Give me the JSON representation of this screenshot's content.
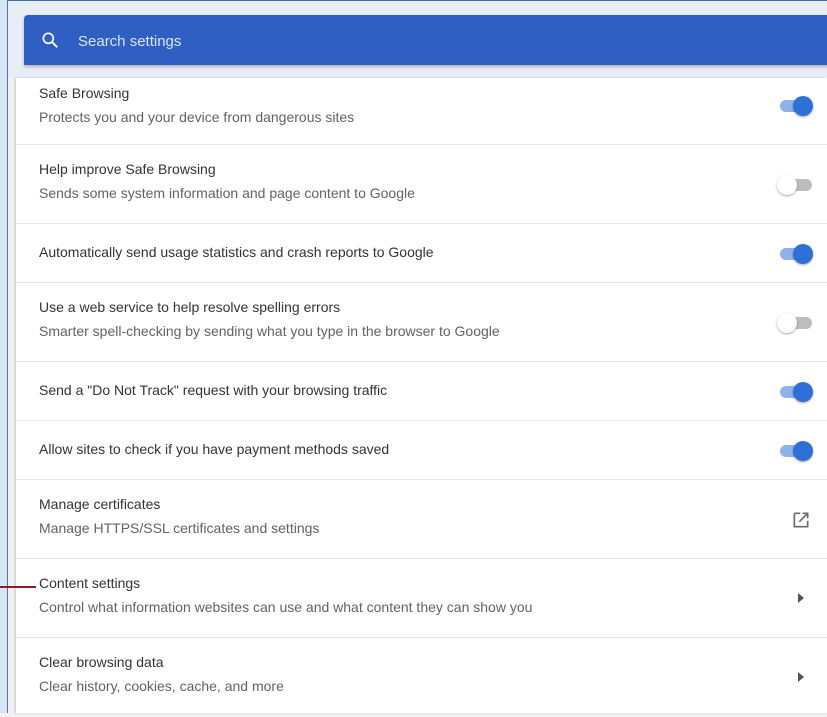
{
  "search": {
    "placeholder": "Search settings",
    "value": ""
  },
  "rows": [
    {
      "title": "Safe Browsing",
      "subtitle": "Protects you and your device from dangerous sites",
      "control": "toggle",
      "checked": true
    },
    {
      "title": "Help improve Safe Browsing",
      "subtitle": "Sends some system information and page content to Google",
      "control": "toggle",
      "checked": false
    },
    {
      "title": "Automatically send usage statistics and crash reports to Google",
      "control": "toggle",
      "checked": true
    },
    {
      "title": "Use a web service to help resolve spelling errors",
      "subtitle": "Smarter spell-checking by sending what you type in the browser to Google",
      "control": "toggle",
      "checked": false
    },
    {
      "title": "Send a \"Do Not Track\" request with your browsing traffic",
      "control": "toggle",
      "checked": true
    },
    {
      "title": "Allow sites to check if you have payment methods saved",
      "control": "toggle",
      "checked": true
    },
    {
      "title": "Manage certificates",
      "subtitle": "Manage HTTPS/SSL certificates and settings",
      "control": "external-link-icon"
    },
    {
      "title": "Content settings",
      "subtitle": "Control what information websites can use and what content they can show you",
      "control": "chevron-right-icon"
    },
    {
      "title": "Clear browsing data",
      "subtitle": "Clear history, cookies, cache, and more",
      "control": "chevron-right-icon"
    }
  ],
  "colors": {
    "header_blue": "#2f5fc2",
    "toggle_on": "#2e70d6",
    "toggle_on_track": "#8fb2ea",
    "toggle_off_track": "#bdbdbd",
    "annotation_marker": "#8b1a2b"
  }
}
